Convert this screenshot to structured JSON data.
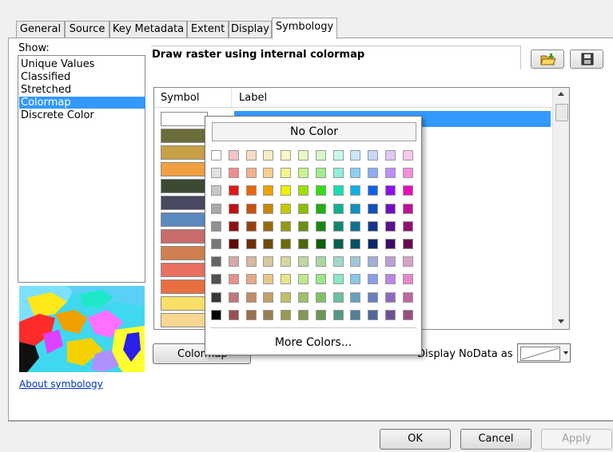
{
  "tabs": [
    "General",
    "Source",
    "Key Metadata",
    "Extent",
    "Display",
    "Symbology"
  ],
  "active_tab": "Symbology",
  "show": {
    "label": "Show:",
    "items": [
      "Unique Values",
      "Classified",
      "Stretched",
      "Colormap",
      "Discrete Color"
    ],
    "selected": "Colormap"
  },
  "description": "Draw raster using internal colormap",
  "table": {
    "headers": [
      "Symbol",
      "Label"
    ],
    "symbol_colors": [
      "#ffffff",
      "#6c6c3a",
      "#c8a048",
      "#f0a040",
      "#3c4a34",
      "#484860",
      "#5c88c0",
      "#c86c6c",
      "#d08050",
      "#e87060",
      "#e87040",
      "#f8e068",
      "#f8d890"
    ]
  },
  "color_picker": {
    "no_color_label": "No Color",
    "more_colors_label": "More Colors...",
    "palette": [
      [
        "#ffffff",
        "#f4c4c4",
        "#f8dcc4",
        "#f8ecc4",
        "#f8f8c4",
        "#e8f8c4",
        "#d4f8c8",
        "#c8f8ec",
        "#c8e8f8",
        "#c8d8f8",
        "#dcc8f8",
        "#f8c8ec"
      ],
      [
        "#e0e0e0",
        "#f08c8c",
        "#f4b08c",
        "#f4d08c",
        "#f4f48c",
        "#c8f48c",
        "#9cf08c",
        "#8cf0d8",
        "#8cd0f4",
        "#8cacf4",
        "#c08cf4",
        "#f48cd8"
      ],
      [
        "#c8c8c8",
        "#e01818",
        "#ec6410",
        "#f0a000",
        "#f0f000",
        "#a0e000",
        "#30e010",
        "#10e0b0",
        "#10b0e8",
        "#1060e8",
        "#9010e8",
        "#e810b8"
      ],
      [
        "#a8a8a8",
        "#c01010",
        "#c85010",
        "#c88800",
        "#c8c800",
        "#88c000",
        "#20b010",
        "#10b090",
        "#1090c0",
        "#1050c0",
        "#7010c0",
        "#c01098"
      ],
      [
        "#909090",
        "#901010",
        "#984010",
        "#986810",
        "#989810",
        "#689010",
        "#188810",
        "#108870",
        "#107090",
        "#103890",
        "#581090",
        "#901070"
      ],
      [
        "#787878",
        "#600808",
        "#6c3008",
        "#6c4c08",
        "#6c6c08",
        "#4c6808",
        "#106008",
        "#086050",
        "#085068",
        "#082868",
        "#400868",
        "#680850"
      ],
      [
        "#646464",
        "#d8a8a8",
        "#d8b8a0",
        "#d8c8a0",
        "#d8d8a0",
        "#c0d8a0",
        "#a8d8a0",
        "#a0d8c8",
        "#a0c8d8",
        "#a0b0d8",
        "#b8a0d8",
        "#d8a0c8"
      ],
      [
        "#505050",
        "#e89090",
        "#e8a888",
        "#e8c888",
        "#e8e888",
        "#c0e888",
        "#98e888",
        "#88e8c8",
        "#88c8e8",
        "#88a0e8",
        "#b888e8",
        "#e888c8"
      ],
      [
        "#383838",
        "#c07878",
        "#c08c68",
        "#c0a068",
        "#c0c068",
        "#a0c068",
        "#80c068",
        "#68c0a0",
        "#68a0c0",
        "#6880c0",
        "#9068c0",
        "#c068a0"
      ],
      [
        "#000000",
        "#985050",
        "#987050",
        "#988050",
        "#989850",
        "#809850",
        "#689850",
        "#509880",
        "#508098",
        "#506898",
        "#705098",
        "#985080"
      ]
    ]
  },
  "buttons": {
    "colormap": "Colormap",
    "ok": "OK",
    "cancel": "Cancel",
    "apply": "Apply"
  },
  "nodata_label": "Display NoData as",
  "about_link": "About symbology"
}
